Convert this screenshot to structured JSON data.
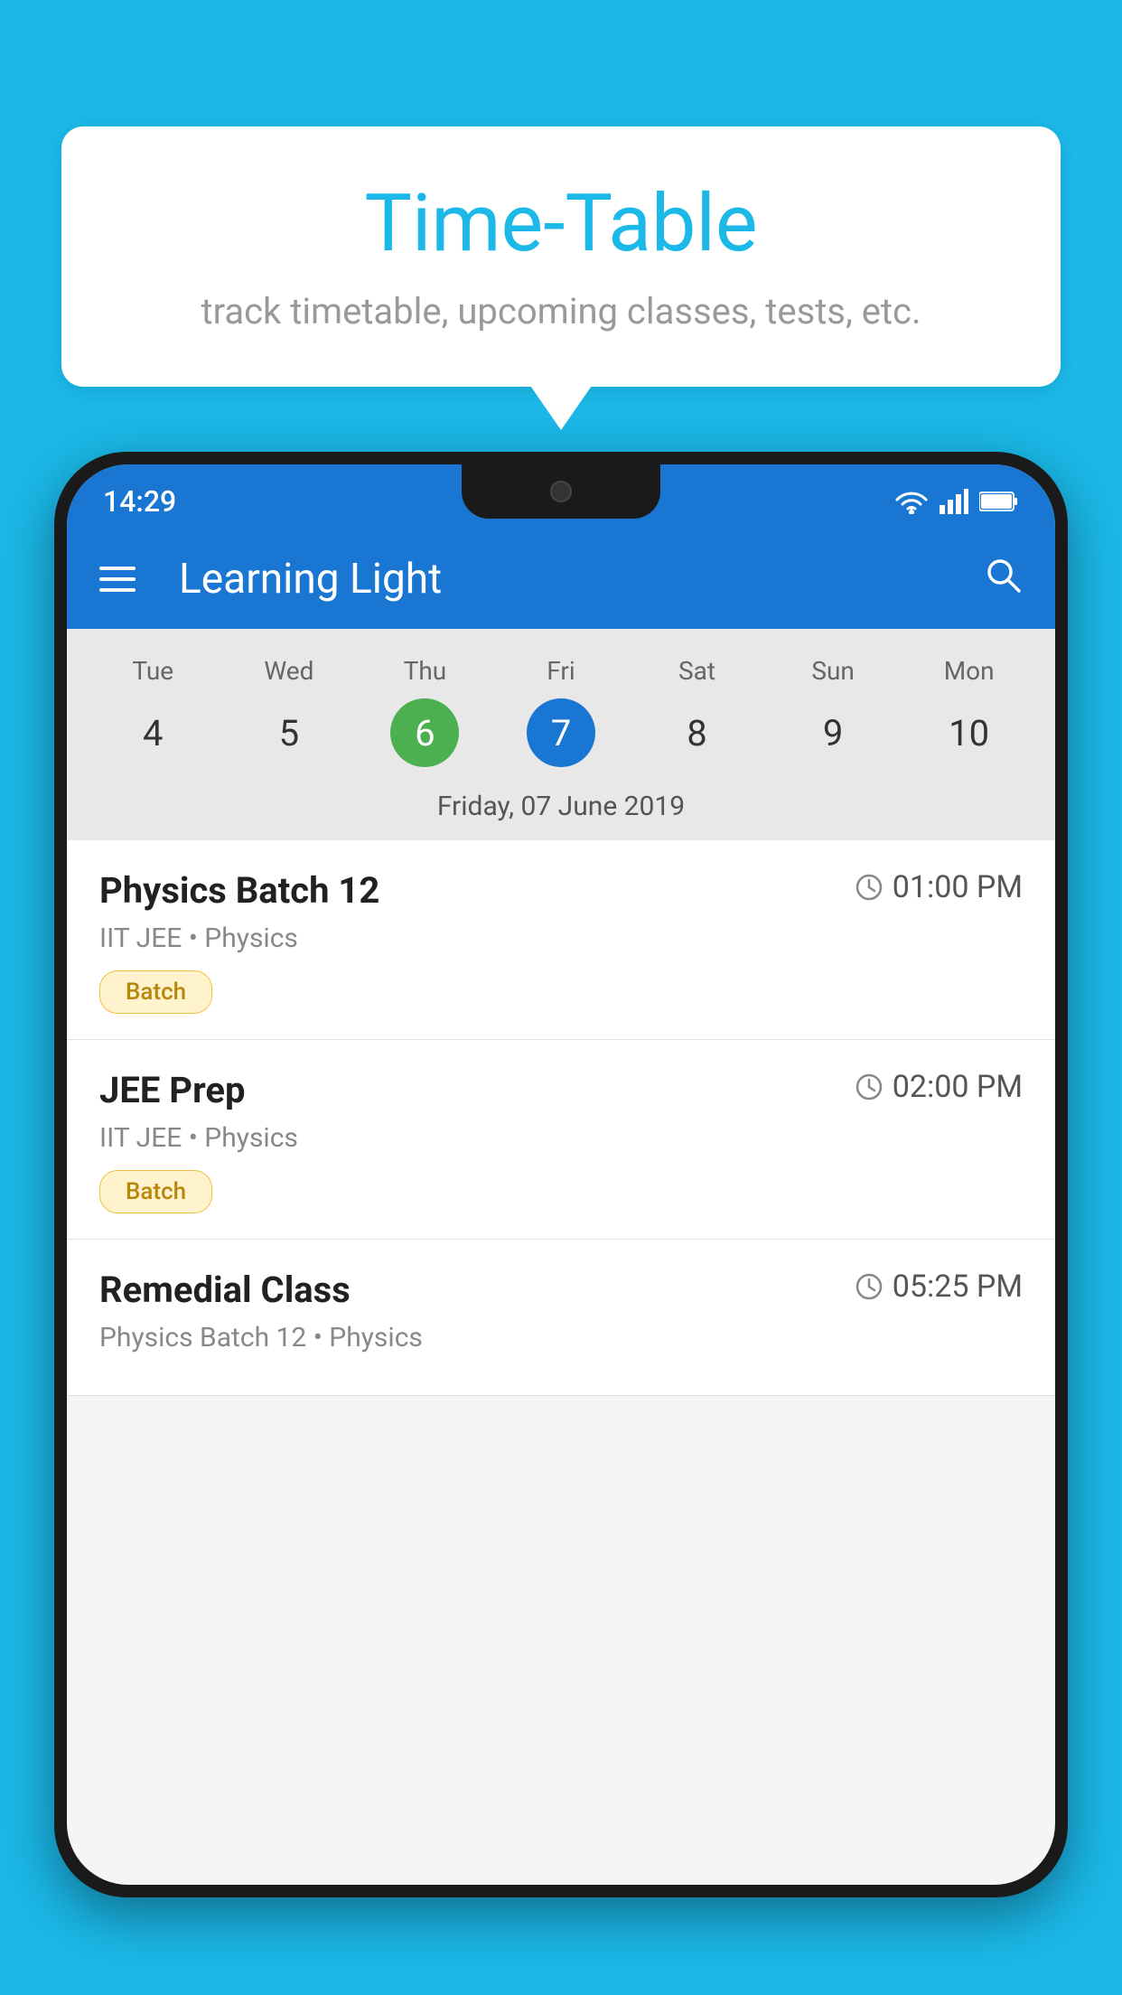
{
  "background_color": "#1BB8E8",
  "bubble": {
    "title": "Time-Table",
    "subtitle": "track timetable, upcoming classes, tests, etc."
  },
  "phone": {
    "status_bar": {
      "time": "14:29"
    },
    "app_bar": {
      "title": "Learning Light"
    },
    "calendar": {
      "days": [
        {
          "label": "Tue",
          "number": "4",
          "state": "normal"
        },
        {
          "label": "Wed",
          "number": "5",
          "state": "normal"
        },
        {
          "label": "Thu",
          "number": "6",
          "state": "today"
        },
        {
          "label": "Fri",
          "number": "7",
          "state": "selected"
        },
        {
          "label": "Sat",
          "number": "8",
          "state": "normal"
        },
        {
          "label": "Sun",
          "number": "9",
          "state": "normal"
        },
        {
          "label": "Mon",
          "number": "10",
          "state": "normal"
        }
      ],
      "selected_date_label": "Friday, 07 June 2019"
    },
    "schedule": [
      {
        "title": "Physics Batch 12",
        "time": "01:00 PM",
        "subtitle": "IIT JEE • Physics",
        "badge": "Batch"
      },
      {
        "title": "JEE Prep",
        "time": "02:00 PM",
        "subtitle": "IIT JEE • Physics",
        "badge": "Batch"
      },
      {
        "title": "Remedial Class",
        "time": "05:25 PM",
        "subtitle": "Physics Batch 12 • Physics",
        "badge": null
      }
    ]
  }
}
